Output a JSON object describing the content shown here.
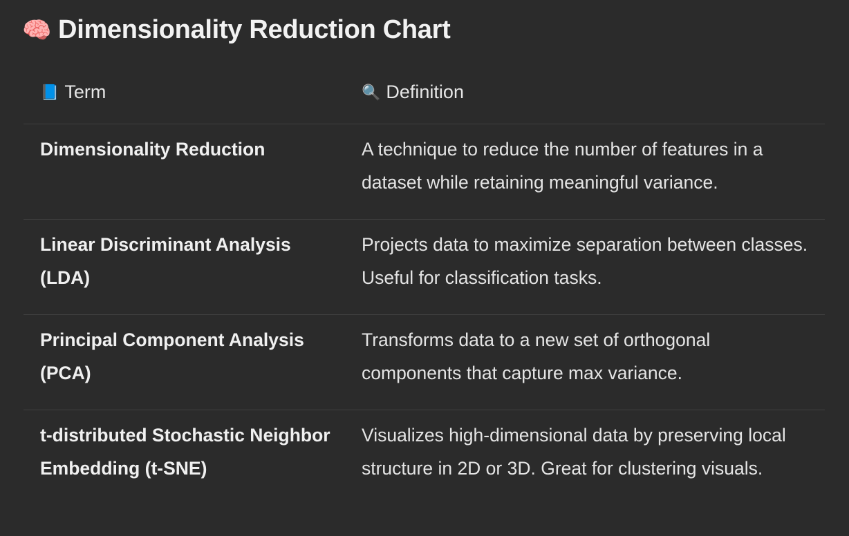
{
  "page": {
    "title_emoji": "🧠",
    "title": "Dimensionality Reduction Chart"
  },
  "table": {
    "headers": {
      "term": {
        "icon": "📘",
        "icon_name": "blue-book-icon",
        "label": "Term"
      },
      "definition": {
        "icon": "🔍",
        "icon_name": "magnifying-glass-icon",
        "label": "Definition"
      }
    },
    "rows": [
      {
        "term": "Dimensionality Reduction",
        "definition": "A technique to reduce the number of features in a dataset while retaining meaningful variance."
      },
      {
        "term": "Linear Discriminant Analysis (LDA)",
        "definition": "Projects data to maximize separation between classes. Useful for classification tasks."
      },
      {
        "term": "Principal Component Analysis (PCA)",
        "definition": "Transforms data to a new set of orthogonal components that capture max variance."
      },
      {
        "term": "t-distributed Stochastic Neighbor Embedding (t-SNE)",
        "definition": "Visualizes high-dimensional data by preserving local structure in 2D or 3D. Great for clustering visuals."
      }
    ]
  },
  "colors": {
    "background": "#2b2b2b",
    "text": "#ececec",
    "divider": "#404040"
  }
}
